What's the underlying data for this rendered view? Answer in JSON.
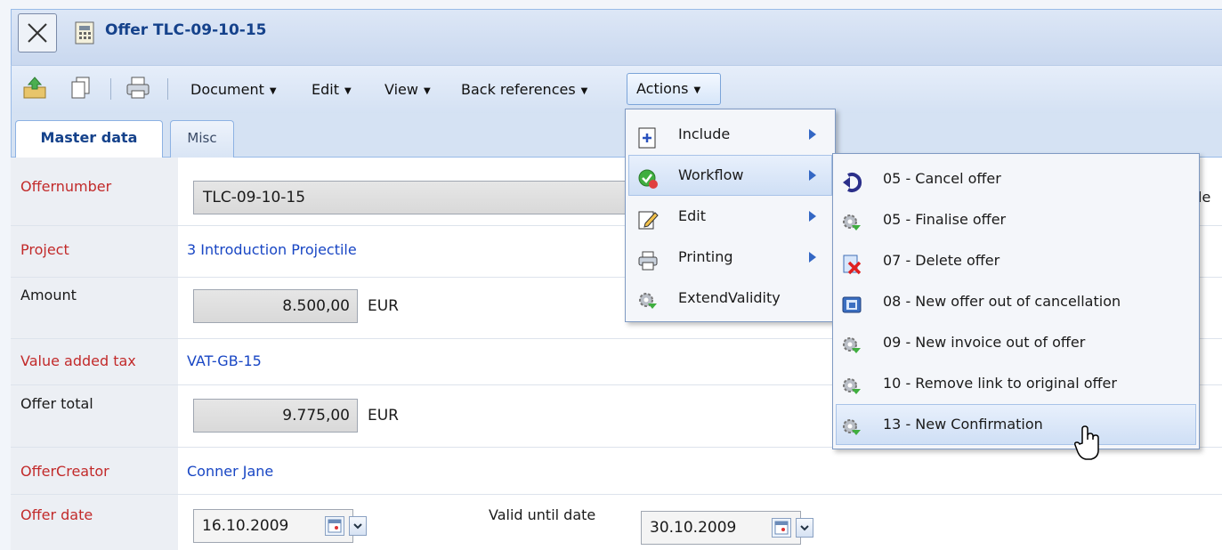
{
  "window": {
    "title": "Offer TLC-09-10-15"
  },
  "toolbar": {
    "menus": [
      "Document",
      "Edit",
      "View",
      "Back references"
    ],
    "actions_label": "Actions"
  },
  "tabs": [
    {
      "label": "Master data",
      "active": true
    },
    {
      "label": "Misc",
      "active": false
    }
  ],
  "form": {
    "offernumber": {
      "label": "Offernumber",
      "value": "TLC-09-10-15"
    },
    "project": {
      "label": "Project",
      "value": "3 Introduction Projectile"
    },
    "amount": {
      "label": "Amount",
      "value": "8.500,00",
      "currency": "EUR"
    },
    "vat": {
      "label": "Value added tax",
      "value": "VAT-GB-15"
    },
    "offer_total": {
      "label": "Offer total",
      "value": "9.775,00",
      "currency": "EUR"
    },
    "offer_creator": {
      "label": "OfferCreator",
      "value": "Conner Jane"
    },
    "offer_date": {
      "label": "Offer date",
      "value": "16.10.2009"
    },
    "valid_until": {
      "label": "Valid until date",
      "value": "30.10.2009"
    },
    "clipped_right_text": "le"
  },
  "actions_menu": {
    "items": [
      {
        "label": "Include",
        "icon": "include-icon",
        "has_submenu": true
      },
      {
        "label": "Workflow",
        "icon": "workflow-icon",
        "has_submenu": true,
        "highlighted": true
      },
      {
        "label": "Edit",
        "icon": "edit-icon",
        "has_submenu": true
      },
      {
        "label": "Printing",
        "icon": "printer-icon",
        "has_submenu": true
      },
      {
        "label": "ExtendValidity",
        "icon": "gear-icon",
        "has_submenu": false
      }
    ]
  },
  "workflow_menu": {
    "items": [
      {
        "label": "05 - Cancel offer",
        "icon": "undo-arrow-icon"
      },
      {
        "label": "05 - Finalise offer",
        "icon": "gear-icon"
      },
      {
        "label": "07 - Delete offer",
        "icon": "delete-document-icon"
      },
      {
        "label": "08 - New offer out of cancellation",
        "icon": "copy-document-icon"
      },
      {
        "label": "09 - New invoice out of offer",
        "icon": "gear-icon"
      },
      {
        "label": "10 - Remove link to original offer",
        "icon": "gear-icon"
      },
      {
        "label": "13 - New Confirmation",
        "icon": "gear-icon",
        "highlighted": true
      }
    ]
  },
  "colors": {
    "label_required": "#c22a2a",
    "link": "#1846c4",
    "title": "#15428b",
    "menu_highlight": "#cfdff5"
  }
}
